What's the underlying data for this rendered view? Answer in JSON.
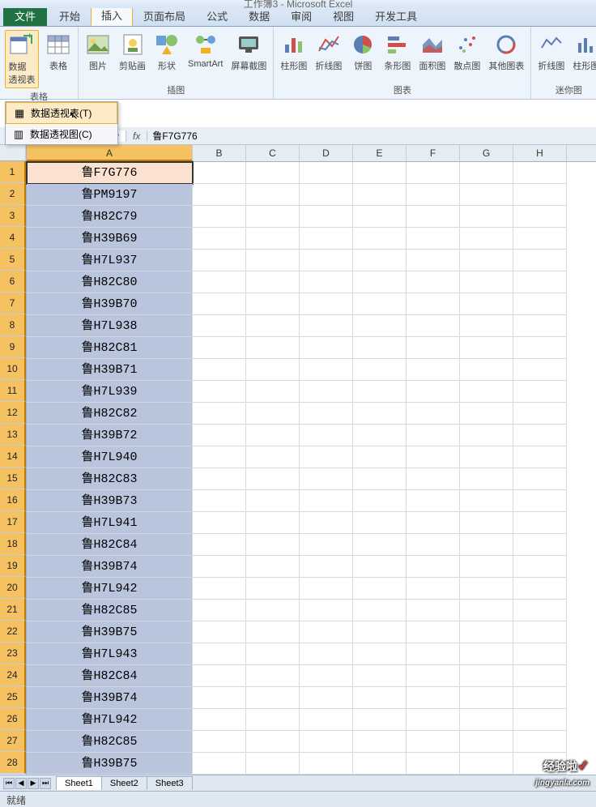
{
  "title": "工作簿3 - Microsoft Excel",
  "tabs": {
    "file": "文件",
    "items": [
      "开始",
      "插入",
      "页面布局",
      "公式",
      "数据",
      "审阅",
      "视图",
      "开发工具"
    ],
    "active_index": 1
  },
  "ribbon": {
    "g1": {
      "label": "表格",
      "pivot": "数据\n透视表",
      "table": "表格"
    },
    "g2": {
      "label": "插图",
      "pic": "图片",
      "clip": "剪贴画",
      "shape": "形状",
      "smartart": "SmartArt",
      "screenshot": "屏幕截图"
    },
    "g3": {
      "label": "图表",
      "col": "柱形图",
      "line": "折线图",
      "pie": "饼图",
      "bar": "条形图",
      "area": "面积图",
      "scatter": "散点图",
      "other": "其他图表"
    },
    "g4": {
      "label": "迷你图",
      "sline": "折线图",
      "scol": "柱形图"
    }
  },
  "dropdown": {
    "pivot_table": "数据透视表(T)",
    "pivot_chart": "数据透视图(C)"
  },
  "namebox": "",
  "formula": "鲁F7G776",
  "columns": [
    "A",
    "B",
    "C",
    "D",
    "E",
    "F",
    "G",
    "H"
  ],
  "cells": [
    "鲁F7G776",
    "鲁PM9197",
    "鲁H82C79",
    "鲁H39B69",
    "鲁H7L937",
    "鲁H82C80",
    "鲁H39B70",
    "鲁H7L938",
    "鲁H82C81",
    "鲁H39B71",
    "鲁H7L939",
    "鲁H82C82",
    "鲁H39B72",
    "鲁H7L940",
    "鲁H82C83",
    "鲁H39B73",
    "鲁H7L941",
    "鲁H82C84",
    "鲁H39B74",
    "鲁H7L942",
    "鲁H82C85",
    "鲁H39B75",
    "鲁H7L943",
    "鲁H82C84",
    "鲁H39B74",
    "鲁H7L942",
    "鲁H82C85",
    "鲁H39B75"
  ],
  "sheets": [
    "Sheet1",
    "Sheet2",
    "Sheet3"
  ],
  "status": "就绪",
  "watermark": {
    "brand": "经验啦",
    "check": "✓",
    "url": "jingyanla.com"
  }
}
